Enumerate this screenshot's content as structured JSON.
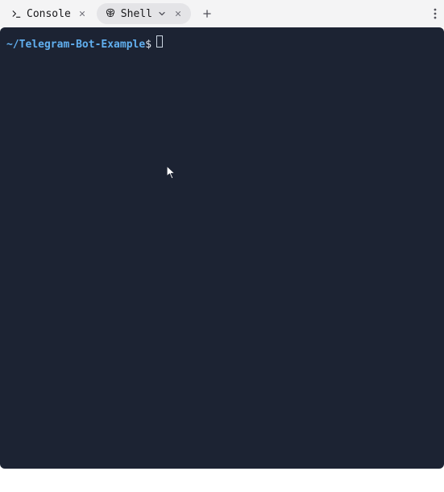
{
  "tabs": {
    "console": {
      "label": "Console"
    },
    "shell": {
      "label": "Shell"
    }
  },
  "terminal": {
    "prompt_path": "~/Telegram-Bot-Example",
    "prompt_symbol": "$"
  }
}
